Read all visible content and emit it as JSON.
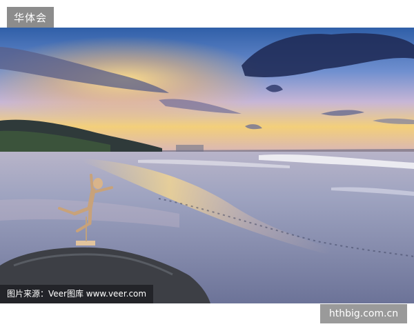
{
  "badge": {
    "label": "华体会"
  },
  "caption": {
    "text": "图片来源：Veer图库 www.veer.com"
  },
  "watermark": {
    "text": "hthbig.com.cn"
  },
  "colors": {
    "badge_bg": "#8c8c8c",
    "watermark_bg": "#9a9a9a",
    "sky_top": "#2f5fa8",
    "sky_glow": "#f6c75e",
    "sea": "#8a93b5",
    "rock": "#3d3f45"
  }
}
